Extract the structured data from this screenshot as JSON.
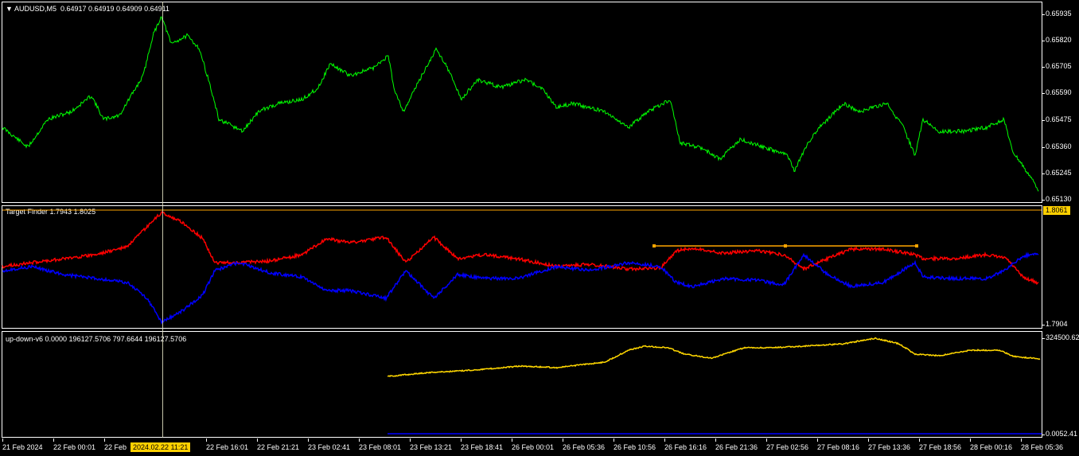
{
  "main": {
    "symbol_label": "AUDUSD,M5",
    "ohlc": "0.64917 0.64919 0.64909 0.64911",
    "price_ticks": [
      "0.65935",
      "0.65820",
      "0.65705",
      "0.65590",
      "0.65475",
      "0.65360",
      "0.65245",
      "0.65130"
    ],
    "line_color": "#00ff00"
  },
  "target_finder": {
    "label": "Target Finder 1.7943 1.8025",
    "top_value": "1.8061",
    "bottom_value": "1.7904",
    "red_color": "#ff0000",
    "blue_color": "#0000ff",
    "trendline_color": "#ffa500"
  },
  "updown": {
    "label": "up-down-v6 0.0000 196127.5706 797.6644 196127.5706",
    "top_value": "324500.62",
    "bottom_value": "0.0052.41",
    "line_color": "#ffd700"
  },
  "time_ticks": [
    "21 Feb 2024",
    "22 Feb 00:01",
    "22 Feb",
    "22 Feb 16:01",
    "22 Feb 21:21",
    "23 Feb 02:41",
    "23 Feb 08:01",
    "23 Feb 13:21",
    "23 Feb 18:41",
    "26 Feb 00:01",
    "26 Feb 05:36",
    "26 Feb 10:56",
    "26 Feb 16:16",
    "26 Feb 21:36",
    "27 Feb 02:56",
    "27 Feb 08:16",
    "27 Feb 13:36",
    "27 Feb 18:56",
    "28 Feb 00:16",
    "28 Feb 05:36"
  ],
  "crosshair_date": "2024.02.22 11:21"
}
